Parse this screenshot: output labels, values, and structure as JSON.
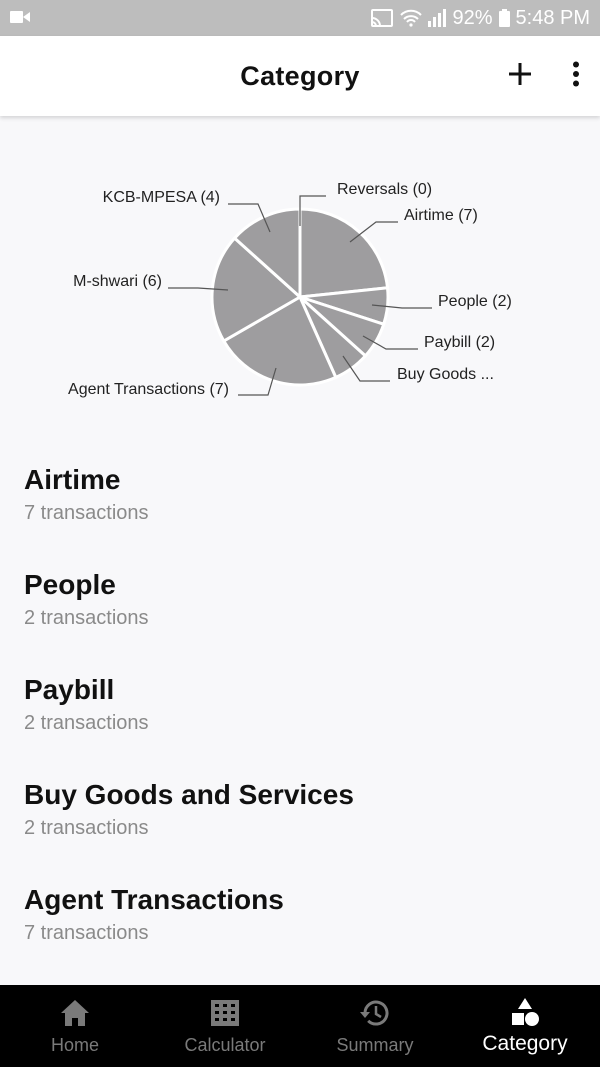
{
  "status_bar": {
    "battery": "92%",
    "time": "5:48 PM"
  },
  "app_bar": {
    "title": "Category",
    "add_icon": "plus-icon",
    "menu_icon": "more-vert-icon"
  },
  "chart_data": {
    "type": "pie",
    "color": "#9e9d9f",
    "slice_border": "#ffffff",
    "slices": [
      {
        "label": "Reversals (0)",
        "value": 0
      },
      {
        "label": "Airtime (7)",
        "value": 7
      },
      {
        "label": "People (2)",
        "value": 2
      },
      {
        "label": "Paybill (2)",
        "value": 2
      },
      {
        "label": "Buy Goods ...",
        "value": 2
      },
      {
        "label": "Agent Transactions (7)",
        "value": 7
      },
      {
        "label": "M-shwari (6)",
        "value": 6
      },
      {
        "label": "KCB-MPESA (4)",
        "value": 4
      }
    ]
  },
  "categories": [
    {
      "name": "Airtime",
      "count": "7 transactions"
    },
    {
      "name": "People",
      "count": "2 transactions"
    },
    {
      "name": "Paybill",
      "count": "2 transactions"
    },
    {
      "name": "Buy Goods and Services",
      "count": "2 transactions"
    },
    {
      "name": "Agent Transactions",
      "count": "7 transactions"
    }
  ],
  "bottom_nav": {
    "items": [
      {
        "label": "Home",
        "icon": "home-icon"
      },
      {
        "label": "Calculator",
        "icon": "calculator-icon"
      },
      {
        "label": "Summary",
        "icon": "history-icon"
      },
      {
        "label": "Category",
        "icon": "shapes-icon"
      }
    ],
    "active": "Category"
  }
}
